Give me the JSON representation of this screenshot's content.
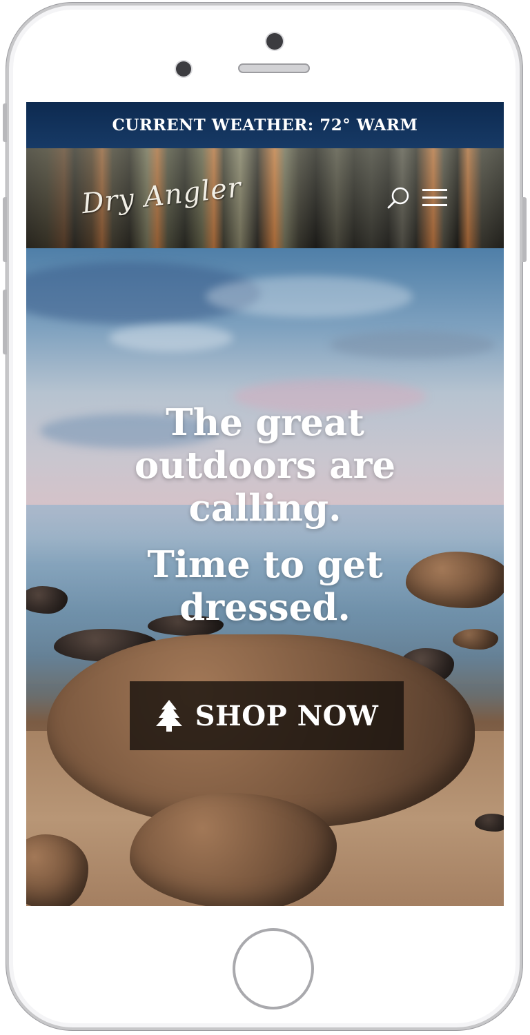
{
  "weather_bar": {
    "text": "CURRENT WEATHER: 72° WARM"
  },
  "header": {
    "logo_text": "Dry Angler",
    "search_icon": "search-icon",
    "menu_icon": "hamburger-menu-icon"
  },
  "hero": {
    "headline_lines": [
      "The great",
      "outdoors are",
      "calling."
    ],
    "subheadline_lines": [
      "Time to get",
      "dressed."
    ],
    "cta": {
      "label": "SHOP NOW",
      "icon": "pine-tree-icon"
    }
  },
  "colors": {
    "weather_bar_bg": "#0d2a50",
    "cta_bg": "#14100c",
    "text": "#ffffff"
  }
}
